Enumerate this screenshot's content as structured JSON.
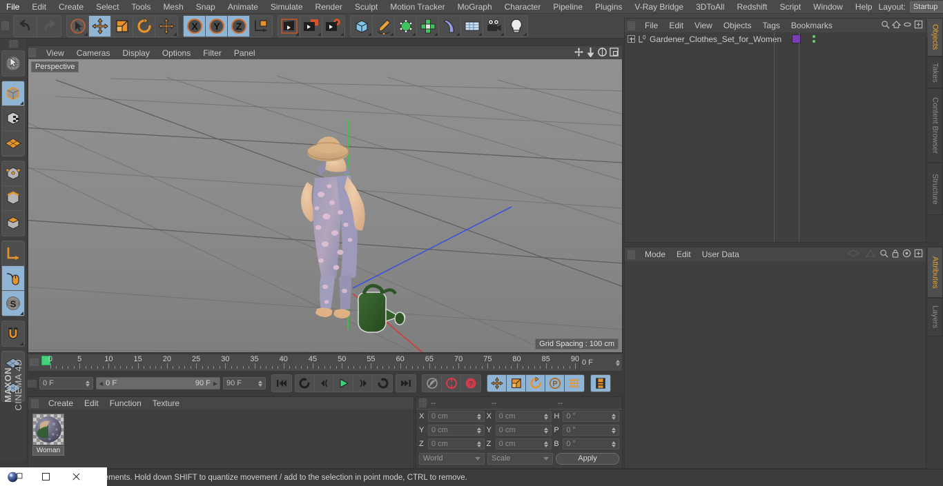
{
  "app": {
    "brand_line1": "MAXON",
    "brand_line2": "CINEMA 4D"
  },
  "menubar": {
    "items": [
      "File",
      "Edit",
      "Create",
      "Select",
      "Tools",
      "Mesh",
      "Snap",
      "Animate",
      "Simulate",
      "Render",
      "Sculpt",
      "Motion Tracker",
      "MoGraph",
      "Character",
      "Pipeline",
      "Plugins",
      "V-Ray Bridge",
      "3DToAll",
      "Redshift",
      "Script",
      "Window",
      "Help"
    ],
    "layout_label": "Layout:",
    "layout_value": "Startup",
    "search_icon": "magnifier-icon"
  },
  "toolbar": {
    "groups": [
      {
        "name": "history",
        "buttons": [
          {
            "icon": "undo-icon",
            "active": false
          },
          {
            "icon": "redo-icon",
            "active": false
          }
        ]
      },
      {
        "name": "transform",
        "buttons": [
          {
            "icon": "select-cursor-icon",
            "active": false
          },
          {
            "icon": "move-icon",
            "active": true
          },
          {
            "icon": "scale-icon",
            "active": false
          },
          {
            "icon": "rotate-icon",
            "active": false
          },
          {
            "icon": "move-duplicate-icon",
            "active": false
          }
        ]
      },
      {
        "name": "axis-locks",
        "buttons": [
          {
            "icon": "axis-x-icon",
            "active": true
          },
          {
            "icon": "axis-y-icon",
            "active": true
          },
          {
            "icon": "axis-z-icon",
            "active": true
          },
          {
            "icon": "world-axis-icon",
            "active": false
          }
        ]
      },
      {
        "name": "render",
        "buttons": [
          {
            "icon": "render-view-icon",
            "active": false
          },
          {
            "icon": "render-picture-viewer-icon",
            "active": false
          },
          {
            "icon": "render-settings-icon",
            "active": false
          }
        ]
      },
      {
        "name": "create",
        "buttons": [
          {
            "icon": "cube-primitive-icon",
            "active": false
          },
          {
            "icon": "spline-pen-icon",
            "active": false
          },
          {
            "icon": "generator-icon",
            "active": false
          },
          {
            "icon": "mograph-cloner-icon",
            "active": false
          },
          {
            "icon": "deformer-bend-icon",
            "active": false
          },
          {
            "icon": "scene-floor-icon",
            "active": false
          },
          {
            "icon": "camera-icon",
            "active": false
          },
          {
            "icon": "light-icon",
            "active": false
          }
        ]
      }
    ]
  },
  "left_toolbar": {
    "groups": [
      {
        "buttons": [
          {
            "icon": "live-selection-icon",
            "active": false
          }
        ]
      },
      {
        "buttons": [
          {
            "icon": "model-mode-icon",
            "active": true
          },
          {
            "icon": "texture-mode-icon",
            "active": false
          },
          {
            "icon": "workplane-mode-icon",
            "active": false
          }
        ]
      },
      {
        "buttons": [
          {
            "icon": "points-mode-icon",
            "active": false
          },
          {
            "icon": "edges-mode-icon",
            "active": false
          },
          {
            "icon": "polygons-mode-icon",
            "active": false
          }
        ]
      },
      {
        "buttons": [
          {
            "icon": "object-axis-icon",
            "active": false
          },
          {
            "icon": "enable-axis-mouse-icon",
            "active": true
          },
          {
            "icon": "soft-selection-icon",
            "active": true
          }
        ]
      },
      {
        "buttons": [
          {
            "icon": "magnet-snap-icon",
            "active": false
          }
        ]
      },
      {
        "buttons": [
          {
            "icon": "workplane-lock-icon",
            "active": false
          },
          {
            "icon": "workplane-icon",
            "active": false
          }
        ]
      }
    ]
  },
  "viewport": {
    "menu": [
      "View",
      "Cameras",
      "Display",
      "Options",
      "Filter",
      "Panel"
    ],
    "header_icons": [
      "pan-icon",
      "dolly-icon",
      "rotate-view-icon",
      "maximize-view-icon"
    ],
    "label": "Perspective",
    "grid_spacing": "Grid Spacing : 100 cm",
    "axis_gizmo": {
      "x_label": "X",
      "y_label": "Y",
      "z_label": "Z",
      "x_color": "#e03b3b",
      "y_color": "#3ec23e",
      "z_color": "#3a54d8"
    },
    "scene": {
      "character": "woman in floral overalls with sun hat and sandals",
      "prop": "green watering can"
    }
  },
  "timeline": {
    "ticks": [
      0,
      5,
      10,
      15,
      20,
      25,
      30,
      35,
      40,
      45,
      50,
      55,
      60,
      65,
      70,
      75,
      80,
      85,
      90
    ],
    "current_frame_marker": 0,
    "end_field": "0 F"
  },
  "transport": {
    "current_frame": "0 F",
    "range_start": "0 F",
    "range_end": "90 F",
    "preview_end": "90 F",
    "buttons": [
      {
        "icon": "go-to-start-icon",
        "active": false
      },
      {
        "icon": "previous-key-icon",
        "active": false
      },
      {
        "icon": "step-back-icon",
        "active": false
      },
      {
        "icon": "play-icon",
        "active": false
      },
      {
        "icon": "step-forward-icon",
        "active": false
      },
      {
        "icon": "next-key-icon",
        "active": false
      },
      {
        "icon": "go-to-end-icon",
        "active": false
      },
      {
        "icon": "record-active-objects-icon",
        "active": false
      },
      {
        "icon": "autokeying-icon",
        "active": false
      },
      {
        "icon": "keyframe-selection-icon",
        "active": false
      },
      {
        "icon": "position-key-icon",
        "active": true
      },
      {
        "icon": "scale-key-icon",
        "active": true
      },
      {
        "icon": "rotation-key-icon",
        "active": true
      },
      {
        "icon": "parameter-key-icon",
        "active": true
      },
      {
        "icon": "point-level-animation-icon",
        "active": true
      },
      {
        "icon": "timeline-icon",
        "active": true
      }
    ]
  },
  "material_manager": {
    "menu": [
      "Create",
      "Edit",
      "Function",
      "Texture"
    ],
    "materials": [
      {
        "name": "Woman"
      }
    ]
  },
  "coordinates": {
    "headers": [
      "--",
      "--",
      "--"
    ],
    "rows": [
      {
        "pos_label": "X",
        "pos_value": "0 cm",
        "size_label": "X",
        "size_value": "0 cm",
        "rot_label": "H",
        "rot_value": "0 °"
      },
      {
        "pos_label": "Y",
        "pos_value": "0 cm",
        "size_label": "Y",
        "size_value": "0 cm",
        "rot_label": "P",
        "rot_value": "0 °"
      },
      {
        "pos_label": "Z",
        "pos_value": "0 cm",
        "size_label": "Z",
        "size_value": "0 cm",
        "rot_label": "B",
        "rot_value": "0 °"
      }
    ],
    "coord_system": "World",
    "mode": "Scale",
    "apply_label": "Apply"
  },
  "object_manager": {
    "menu": [
      "File",
      "Edit",
      "View",
      "Objects",
      "Tags",
      "Bookmarks"
    ],
    "header_icons": [
      "search-icon",
      "home-icon",
      "ellipse-icon",
      "fit-icon"
    ],
    "items": [
      {
        "name": "Gardener_Clothes_Set_for_Women",
        "layer_badge": "0",
        "tag_color": "#7b3fb5"
      }
    ]
  },
  "attribute_manager": {
    "menu": [
      "Mode",
      "Edit",
      "User Data"
    ],
    "header_icons": [
      "back-history-icon",
      "forward-history-icon",
      "search-icon",
      "lock-icon",
      "target-icon",
      "fit-icon"
    ]
  },
  "right_tabs_top": [
    {
      "label": "Objects",
      "active": true
    },
    {
      "label": "Takes",
      "active": false
    },
    {
      "label": "Content Browser",
      "active": false
    },
    {
      "label": "Structure",
      "active": false
    }
  ],
  "right_tabs_bottom": [
    {
      "label": "Attributes",
      "active": true
    },
    {
      "label": "Layers",
      "active": false
    }
  ],
  "status_bar": {
    "message": "Click and drag to move elements. Hold down SHIFT to quantize movement / add to the selection in point mode, CTRL to remove."
  },
  "taskbar": {
    "buttons": [
      "app-icon",
      "restore-icon",
      "minimize-icon",
      "close-icon"
    ]
  },
  "colors": {
    "accent_active": "#8fb4d4",
    "tab_active_text": "#e0a33c",
    "orange": "#e8922a",
    "green_marker": "#44d17a"
  }
}
